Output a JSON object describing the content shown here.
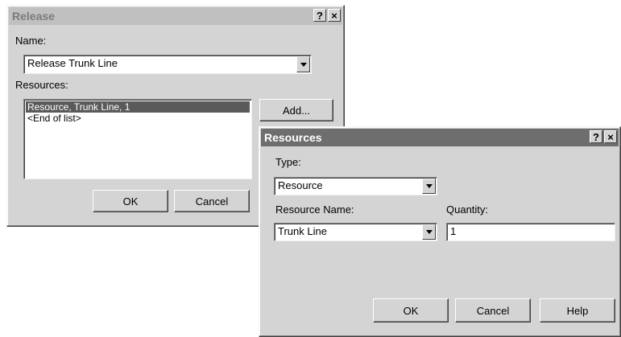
{
  "release_dialog": {
    "title": "Release",
    "help_glyph": "?",
    "close_glyph": "×",
    "name_label": "Name:",
    "name_value": "Release Trunk Line",
    "resources_label": "Resources:",
    "resources_items": [
      "Resource, Trunk Line, 1",
      "<End of list>"
    ],
    "add_label": "Add...",
    "ok_label": "OK",
    "cancel_label": "Cancel"
  },
  "resources_dialog": {
    "title": "Resources",
    "help_glyph": "?",
    "close_glyph": "×",
    "type_label": "Type:",
    "type_value": "Resource",
    "resource_name_label": "Resource Name:",
    "resource_name_value": "Trunk Line",
    "quantity_label": "Quantity:",
    "quantity_value": "1",
    "ok_label": "OK",
    "cancel_label": "Cancel",
    "help_label": "Help"
  }
}
